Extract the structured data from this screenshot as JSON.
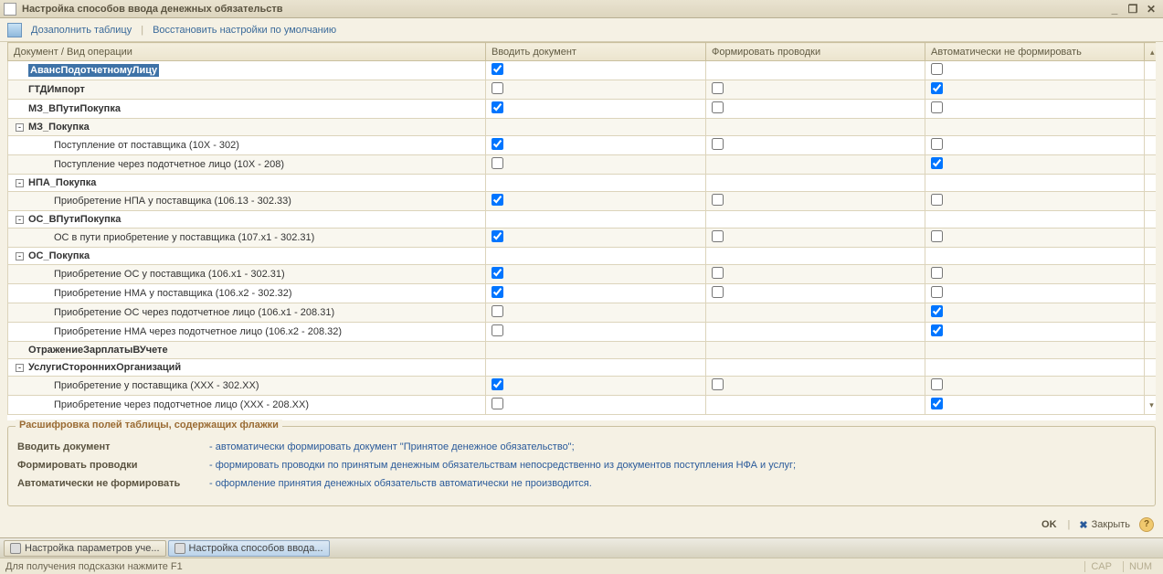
{
  "window": {
    "title": "Настройка способов ввода денежных обязательств"
  },
  "toolbar": {
    "fill": "Дозаполнить таблицу",
    "reset": "Восстановить настройки по умолчанию"
  },
  "columns": {
    "doc": "Документ / Вид операции",
    "c1": "Вводить документ",
    "c2": "Формировать проводки",
    "c3": "Автоматически не формировать"
  },
  "rows": [
    {
      "level": 0,
      "exp": null,
      "label": "АвансПодотчетномуЛицу",
      "sel": true,
      "c1": true,
      "c2": null,
      "c3": false
    },
    {
      "level": 0,
      "exp": null,
      "label": "ГТДИмпорт",
      "c1": false,
      "c2": false,
      "c3": true
    },
    {
      "level": 0,
      "exp": null,
      "label": "МЗ_ВПутиПокупка",
      "c1": true,
      "c2": false,
      "c3": false
    },
    {
      "level": 0,
      "exp": "-",
      "label": "МЗ_Покупка",
      "c1": null,
      "c2": null,
      "c3": null
    },
    {
      "level": 1,
      "label": "Поступление от поставщика (10X - 302)",
      "c1": true,
      "c2": false,
      "c3": false
    },
    {
      "level": 1,
      "label": "Поступление через подотчетное лицо (10X - 208)",
      "c1": false,
      "c2": null,
      "c3": true
    },
    {
      "level": 0,
      "exp": "-",
      "label": "НПА_Покупка",
      "c1": null,
      "c2": null,
      "c3": null
    },
    {
      "level": 1,
      "label": "Приобретение НПА у поставщика (106.13 - 302.33)",
      "c1": true,
      "c2": false,
      "c3": false
    },
    {
      "level": 0,
      "exp": "-",
      "label": "ОС_ВПутиПокупка",
      "c1": null,
      "c2": null,
      "c3": null
    },
    {
      "level": 1,
      "label": "ОС в пути приобретение у поставщика (107.x1 - 302.31)",
      "c1": true,
      "c2": false,
      "c3": false
    },
    {
      "level": 0,
      "exp": "-",
      "label": "ОС_Покупка",
      "c1": null,
      "c2": null,
      "c3": null
    },
    {
      "level": 1,
      "label": "Приобретение ОС у поставщика (106.x1 - 302.31)",
      "c1": true,
      "c2": false,
      "c3": false
    },
    {
      "level": 1,
      "label": "Приобретение НМА у поставщика (106.x2 - 302.32)",
      "c1": true,
      "c2": false,
      "c3": false
    },
    {
      "level": 1,
      "label": "Приобретение ОС через подотчетное лицо (106.x1 - 208.31)",
      "c1": false,
      "c2": null,
      "c3": true
    },
    {
      "level": 1,
      "label": "Приобретение НМА через подотчетное лицо (106.x2 - 208.32)",
      "c1": false,
      "c2": null,
      "c3": true
    },
    {
      "level": 0,
      "exp": null,
      "label": "ОтражениеЗарплатыВУчете",
      "c1": null,
      "c2": null,
      "c3": null
    },
    {
      "level": 0,
      "exp": "-",
      "label": "УслугиСтороннихОрганизаций",
      "c1": null,
      "c2": null,
      "c3": null
    },
    {
      "level": 1,
      "label": "Приобретение у поставщика (XXX - 302.XX)",
      "c1": true,
      "c2": false,
      "c3": false
    },
    {
      "level": 1,
      "label": "Приобретение через подотчетное лицо (XXX - 208.XX)",
      "c1": false,
      "c2": null,
      "c3": true
    }
  ],
  "legend": {
    "title": "Расшифровка полей таблицы, содержащих флажки",
    "r1l": "Вводить документ",
    "r1d": "- автоматически формировать документ \"Принятое денежное обязательство\";",
    "r2l": "Формировать проводки",
    "r2d": "- формировать проводки по принятым денежным обязательствам непосредственно из документов поступления НФА и услуг;",
    "r3l": "Автоматически не формировать",
    "r3d": "- оформление принятия денежных обязательств автоматически не производится."
  },
  "footer": {
    "ok": "OK",
    "close": "Закрыть"
  },
  "taskbar": {
    "t1": "Настройка параметров уче...",
    "t2": "Настройка способов ввода..."
  },
  "status": {
    "hint": "Для получения подсказки нажмите F1",
    "cap": "CAP",
    "num": "NUM"
  }
}
